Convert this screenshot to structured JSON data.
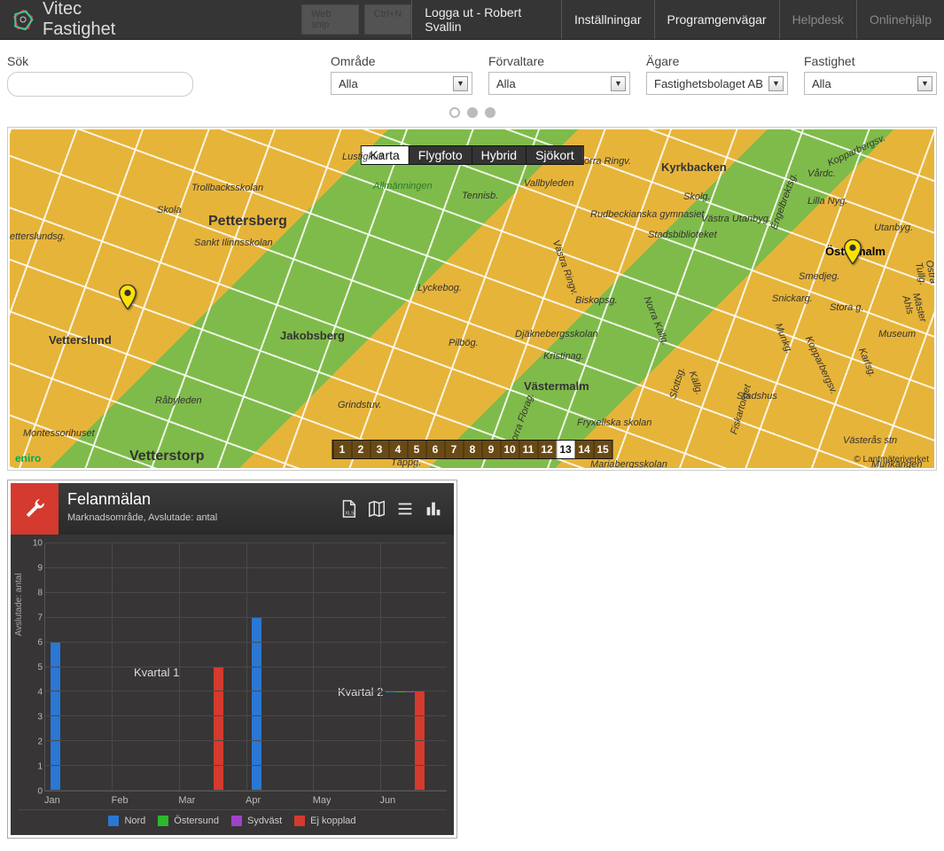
{
  "app_title": "Vitec Fastighet",
  "topnav": {
    "logout": "Logga ut - Robert Svallin",
    "settings": "Inställningar",
    "shortcuts": "Programgenvägar",
    "helpdesk": "Helpdesk",
    "onlinehelp": "Onlinehjälp"
  },
  "ghost": {
    "btn1": "Web snip",
    "btn2": "Ctrl+N"
  },
  "filters": {
    "sok": {
      "label": "Sök",
      "value": ""
    },
    "omrade": {
      "label": "Område",
      "value": "Alla"
    },
    "forvaltare": {
      "label": "Förvaltare",
      "value": "Alla"
    },
    "agare": {
      "label": "Ägare",
      "value": "Fastighetsbolaget AB"
    },
    "fastighet": {
      "label": "Fastighet",
      "value": "Alla"
    }
  },
  "map": {
    "types": [
      "Karta",
      "Flygfoto",
      "Hybrid",
      "Sjökort"
    ],
    "type_active": 0,
    "zoom_levels": [
      "1",
      "2",
      "3",
      "4",
      "5",
      "6",
      "7",
      "8",
      "9",
      "10",
      "11",
      "12",
      "13",
      "14",
      "15"
    ],
    "zoom_active": "13",
    "attrib": "© Lantmäteriverket",
    "eniro": "eniro",
    "labels": {
      "pettersberg": "Pettersberg",
      "jakobsberg": "Jakobsberg",
      "vastermalm": "Västermalm",
      "vetterstorp": "Vetterstorp",
      "vetterslund": "Vetterslund",
      "kyrkbacken": "Kyrkbacken",
      "ostermalm": "Östermalm",
      "skola": "Skola",
      "trollbacksskolan": "Trollbacksskolan",
      "lustigkull": "Lustigkull",
      "allmanningen": "Allmänningen",
      "tennisb": "Tennisb.",
      "sankt": "Sankt Ilinnsskolan",
      "rudbeck": "Rudbeckianska gymnasiet",
      "stadsbib": "Stadsbiblioteket",
      "lyckebog": "Lyckebog.",
      "grindstuv": "Grindstuv.",
      "montessori": "Montessorihuset",
      "rabyleden": "Råbyleden",
      "biskopsg": "Biskopsg.",
      "stadshus": "Stadshus",
      "museum": "Museum",
      "vasteras": "Västerås stn",
      "djak": "Djäknebergsskolan",
      "fryx": "Fryxellska skolan",
      "ettersslund": "etterslundsg.",
      "pilbog": "Pilbög.",
      "norraringv": "Norra Ringv.",
      "vardc": "Vårdc.",
      "lillanyg": "Lilla Nyg.",
      "utanbyg": "Utanbyg.",
      "smedjeg": "Smedjeg.",
      "snickarg": "Snickarg.",
      "storag": "Stora g.",
      "skolg": "Skolg.",
      "vastrautanbyg": "Västra Utanbyg.",
      "kristinag": "Kristinag.",
      "tappg": "Täppg.",
      "mariabergsskolan": "Mariabergsskolan",
      "vasteraringv": "Västra Ringv.",
      "norraflorag": "Norra Florag.",
      "engelbrektsg": "Engelbrektsg.",
      "kopparbergsv": "Kopparbergsv.",
      "munkangen": "Munkängen",
      "masterahls": "Mäster Ahls",
      "karlsg": "Karlsg.",
      "ostratullg": "Östra Tullg.",
      "kopparberg2": "Kopparbergsv.",
      "munkg": "Munkg.",
      "vallbyleden": "Vallbyleden",
      "fiskartorget": "Fiskartorget",
      "slottsg": "Slottsg.",
      "kallg": "Källg.",
      "norrakallg": "Norra Källg."
    }
  },
  "widget": {
    "title": "Felanmälan",
    "subtitle": "Marknadsområde, Avslutade: antal",
    "q1": "Kvartal 1",
    "q2": "Kvartal 2"
  },
  "chart_data": {
    "type": "bar",
    "categories": [
      "Jan",
      "Feb",
      "Mar",
      "Apr",
      "May",
      "Jun"
    ],
    "series": [
      {
        "name": "Nord",
        "color": "#2a77d4",
        "values": [
          6,
          0,
          0,
          7,
          0,
          0
        ]
      },
      {
        "name": "Östersund",
        "color": "#2db82d",
        "values": [
          0,
          0,
          0,
          0,
          0,
          0
        ]
      },
      {
        "name": "Sydväst",
        "color": "#a042c7",
        "values": [
          0,
          0,
          0,
          0,
          0,
          0
        ]
      },
      {
        "name": "Ej kopplad",
        "color": "#d43a2e",
        "values": [
          0,
          0,
          5,
          0,
          0,
          4
        ]
      }
    ],
    "ylabel": "Avslutade: antal",
    "ylim": [
      0,
      10
    ],
    "yticks": [
      0,
      1,
      2,
      3,
      4,
      5,
      6,
      7,
      8,
      9,
      10
    ]
  }
}
